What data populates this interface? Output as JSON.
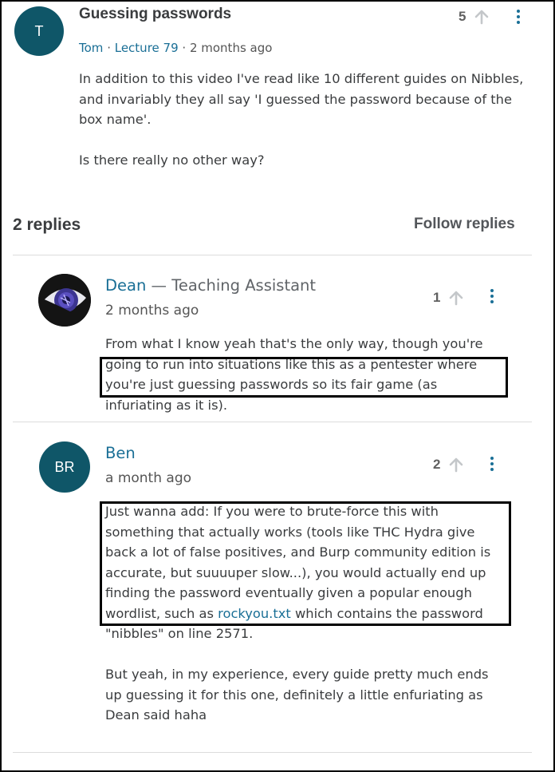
{
  "question": {
    "avatar_initial": "T",
    "title": "Guessing passwords",
    "author": "Tom",
    "lecture": "Lecture 79",
    "time": "2 months ago",
    "votes": "5",
    "body_p1": "In addition to this video I've read like 10 different guides on Nibbles, and invariably they all say 'I guessed the password because of the box name'.",
    "body_p2": "Is there really no other way?"
  },
  "replies_header": {
    "count": "2 replies",
    "follow_label": "Follow replies"
  },
  "replies": [
    {
      "name": "Dean",
      "role": " — Teaching Assistant",
      "time": "2 months ago",
      "votes": "1",
      "text_pre": "From what I know yeah that's the only way, though you're going to run into situations like this as a pentester where you're just guessing passwords so its fair game (as infuriating as it is)."
    },
    {
      "avatar_initials": "BR",
      "name": "Ben",
      "time": "a month ago",
      "votes": "2",
      "text_pre": "Just wanna add: If you were to brute-force this with something that actually works (tools like THC Hydra give back a lot of false positives, and Burp community edition is accurate, but suuuuper slow...), you would actually end up finding the password eventually given a popular enough wordlist, such as ",
      "text_link": "rockyou.txt",
      "text_post": " which contains the password \"nibbles\" on line 2571.",
      "text_p2": "But yeah, in my experience, every guide pretty much ends up guessing it for this one, definitely a little enfuriating as Dean said haha"
    }
  ],
  "colors": {
    "avatar": "#0f5668",
    "link": "#1a6f96",
    "text": "#3a3c3e"
  }
}
